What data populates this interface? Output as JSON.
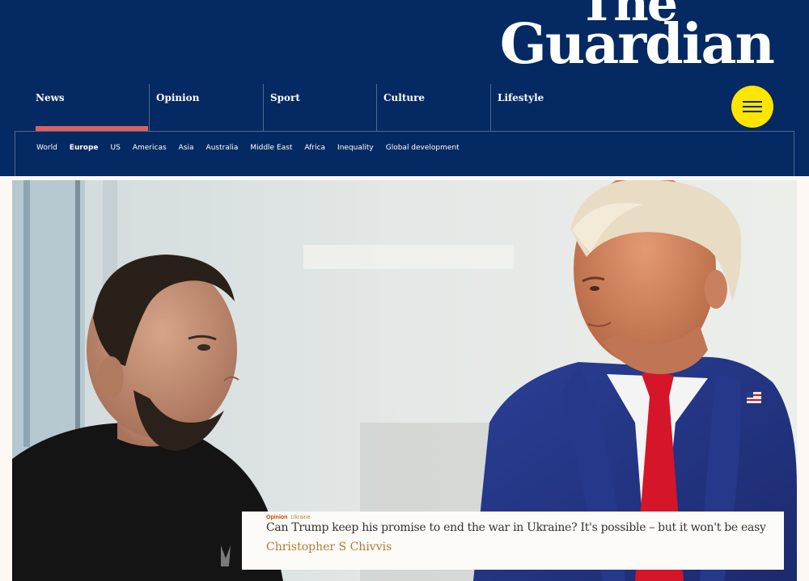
{
  "brand": {
    "line1": "The",
    "line2": "Guardian"
  },
  "pillars": [
    {
      "label": "News"
    },
    {
      "label": "Opinion"
    },
    {
      "label": "Sport"
    },
    {
      "label": "Culture"
    },
    {
      "label": "Lifestyle"
    }
  ],
  "subnav": [
    {
      "label": "World"
    },
    {
      "label": "Europe"
    },
    {
      "label": "US"
    },
    {
      "label": "Americas"
    },
    {
      "label": "Asia"
    },
    {
      "label": "Australia"
    },
    {
      "label": "Middle East"
    },
    {
      "label": "Africa"
    },
    {
      "label": "Inequality"
    },
    {
      "label": "Global development"
    }
  ],
  "article": {
    "section": "Opinion",
    "tag": "Ukraine",
    "headline": "Can Trump keep his promise to end the war in Ukraine? It's possible – but it won't be easy",
    "byline": "Christopher S Chivvis"
  },
  "colors": {
    "brand_blue": "#052962",
    "menu_yellow": "#ffe500",
    "active_underline": "#e15f5f",
    "opinion_orange": "#c74600"
  }
}
